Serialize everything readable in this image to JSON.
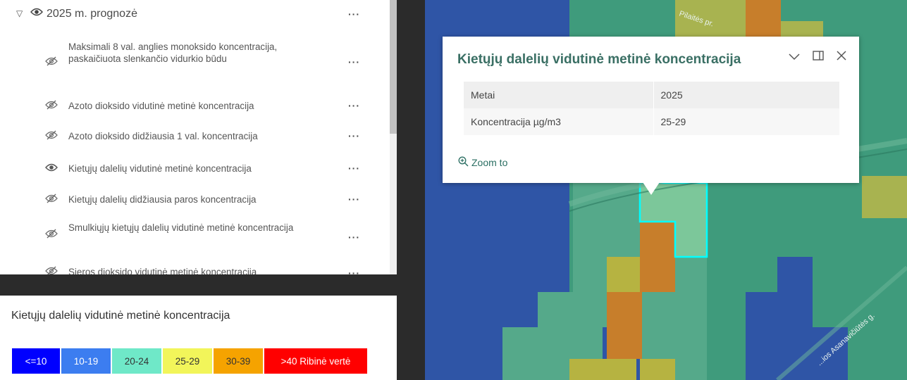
{
  "layers": {
    "group_label": "2025 m. prognozė",
    "menu_glyph": "···",
    "items": [
      {
        "label": "Maksimali 8 val. anglies monoksido koncentracija, paskaičiuota slenkančio vidurkio būdu",
        "visible": false
      },
      {
        "label": "Azoto dioksido vidutinė metinė koncentracija",
        "visible": false
      },
      {
        "label": "Azoto dioksido didžiausia 1 val. koncentracija",
        "visible": false
      },
      {
        "label": "Kietųjų dalelių vidutinė metinė koncentracija",
        "visible": true
      },
      {
        "label": "Kietųjų dalelių didžiausia paros koncentracija",
        "visible": false
      },
      {
        "label": "Smulkiųjų kietųjų dalelių vidutinė metinė koncentracija",
        "visible": false
      },
      {
        "label": "Sieros dioksido vidutinė metinė koncentracija",
        "visible": false
      }
    ]
  },
  "legend": {
    "title": "Kietųjų dalelių vidutinė metinė koncentracija",
    "classes": [
      {
        "label": "<=10",
        "color": "#0000ff",
        "text_color": "#ffffff"
      },
      {
        "label": "10-19",
        "color": "#3c7df0",
        "text_color": "#ffffff"
      },
      {
        "label": "20-24",
        "color": "#6fe8c8",
        "text_color": "#333333"
      },
      {
        "label": "25-29",
        "color": "#f2f55a",
        "text_color": "#333333"
      },
      {
        "label": "30-39",
        "color": "#f5a300",
        "text_color": "#333333"
      },
      {
        "label": ">40 Ribinė vertė",
        "color": "#ff0000",
        "text_color": "#ffffff"
      }
    ]
  },
  "map": {
    "street_labels": [
      "Pilaitės pr.",
      "...ios Asanavičiūtės g."
    ]
  },
  "popup": {
    "title": "Kietųjų dalelių vidutinė metinė koncentracija",
    "rows": [
      {
        "key": "Metai",
        "value": "2025"
      },
      {
        "key": "Koncentracija µg/m3",
        "value": "25-29"
      }
    ],
    "zoom_label": "Zoom to",
    "icons": [
      "chevron-down-icon",
      "dock-icon",
      "close-icon"
    ]
  }
}
